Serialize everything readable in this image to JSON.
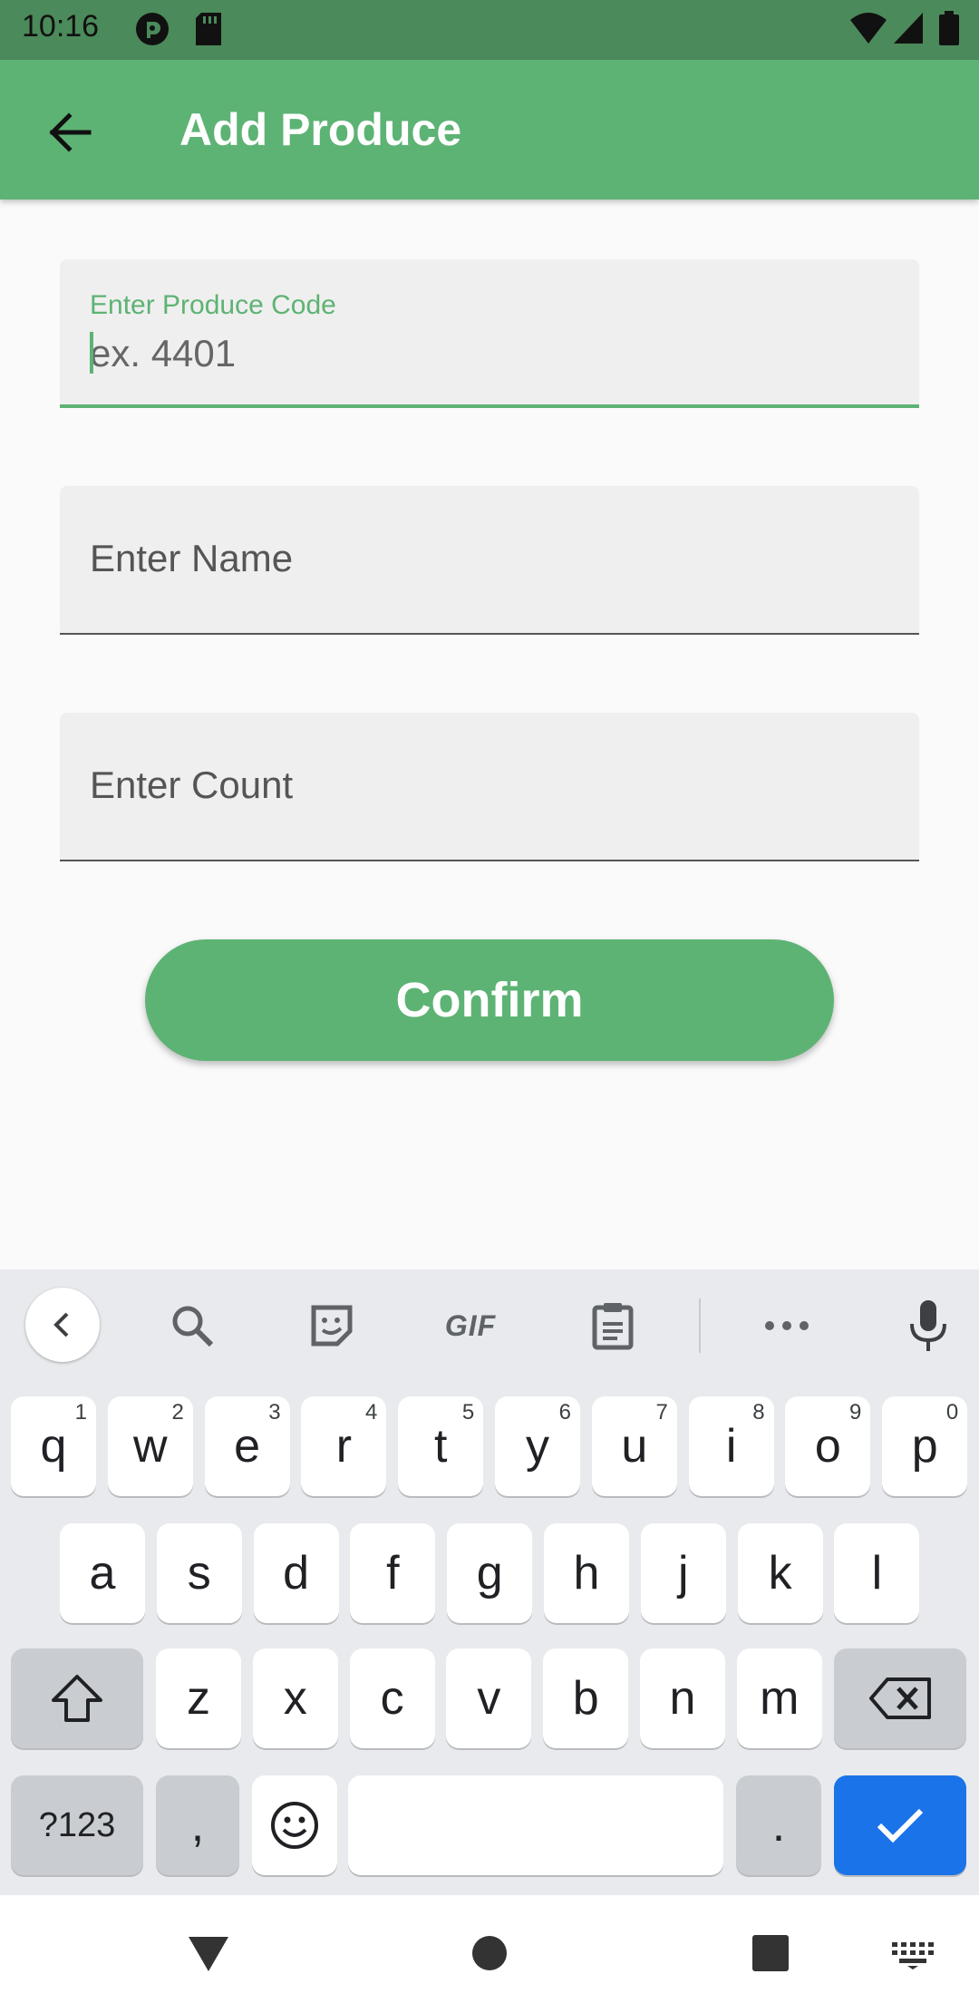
{
  "status_bar": {
    "time": "10:16",
    "icons": [
      "pocket-casts-icon",
      "sd-card-icon",
      "wifi-icon",
      "cellular-signal-icon",
      "battery-icon"
    ]
  },
  "app_bar": {
    "title": "Add Produce",
    "back_icon": "arrow-left-icon",
    "color": "#5db374"
  },
  "form": {
    "code_field": {
      "label": "Enter Produce Code",
      "placeholder": "ex. 4401",
      "focused": true
    },
    "name_field": {
      "placeholder": "Enter Name"
    },
    "count_field": {
      "placeholder": "Enter Count"
    },
    "confirm_label": "Confirm"
  },
  "keyboard": {
    "toolbar": [
      "chevron-left-icon",
      "search-icon",
      "sticker-icon",
      "GIF",
      "clipboard-icon",
      "more-icon",
      "mic-icon"
    ],
    "gif_label": "GIF",
    "row1": [
      {
        "k": "q",
        "h": "1"
      },
      {
        "k": "w",
        "h": "2"
      },
      {
        "k": "e",
        "h": "3"
      },
      {
        "k": "r",
        "h": "4"
      },
      {
        "k": "t",
        "h": "5"
      },
      {
        "k": "y",
        "h": "6"
      },
      {
        "k": "u",
        "h": "7"
      },
      {
        "k": "i",
        "h": "8"
      },
      {
        "k": "o",
        "h": "9"
      },
      {
        "k": "p",
        "h": "0"
      }
    ],
    "row2": [
      "a",
      "s",
      "d",
      "f",
      "g",
      "h",
      "j",
      "k",
      "l"
    ],
    "row3": [
      "z",
      "x",
      "c",
      "v",
      "b",
      "n",
      "m"
    ],
    "symbols_label": "?123",
    "comma_label": ",",
    "period_label": ".",
    "action_color": "#1a73e8"
  },
  "nav_bar": {
    "icons": [
      "back-triangle-icon",
      "home-circle-icon",
      "recents-square-icon",
      "keyboard-switch-icon"
    ]
  }
}
